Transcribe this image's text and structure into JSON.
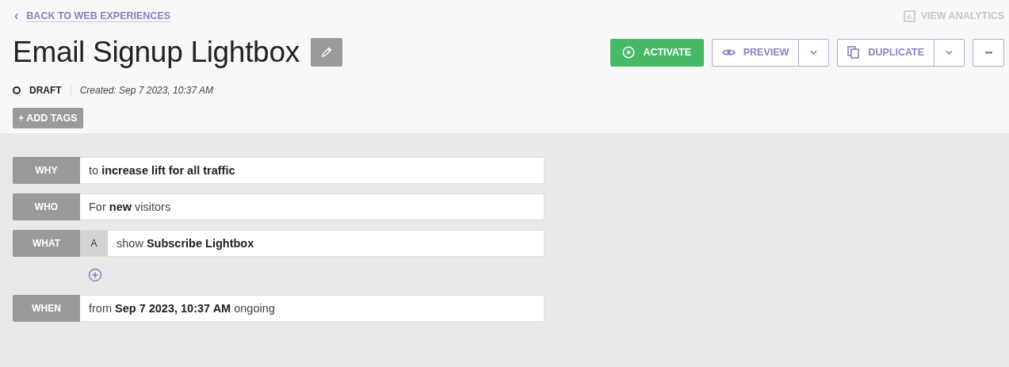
{
  "back_link": {
    "icon": "‹",
    "label": "BACK TO WEB EXPERIENCES"
  },
  "view_analytics": {
    "label": "VIEW ANALYTICS",
    "disabled": true
  },
  "title": "Email Signup Lightbox",
  "actions": [
    {
      "kind": "primary",
      "label": "ACTIVATE"
    },
    {
      "kind": "preview",
      "label": "PREVIEW"
    },
    {
      "kind": "duplicate",
      "label": "DUPLICATE"
    },
    {
      "kind": "more",
      "label": "•••"
    }
  ],
  "status": {
    "label": "DRAFT",
    "created": "Created: Sep 7 2023, 10:37 AM"
  },
  "add_tags": "+ ADD TAGS",
  "rows": [
    {
      "kind": "plain",
      "label": "WHY",
      "text": "to **increase lift for all traffic**"
    },
    {
      "kind": "plain",
      "label": "WHO",
      "text": "For **new** visitors"
    },
    {
      "kind": "variant",
      "label": "WHAT",
      "variant": "A",
      "text": "show **Subscribe Lightbox**"
    },
    {
      "kind": "add"
    },
    {
      "kind": "plain",
      "label": "WHEN",
      "text": "from **Sep 7 2023, 10:37 AM** ongoing"
    }
  ]
}
